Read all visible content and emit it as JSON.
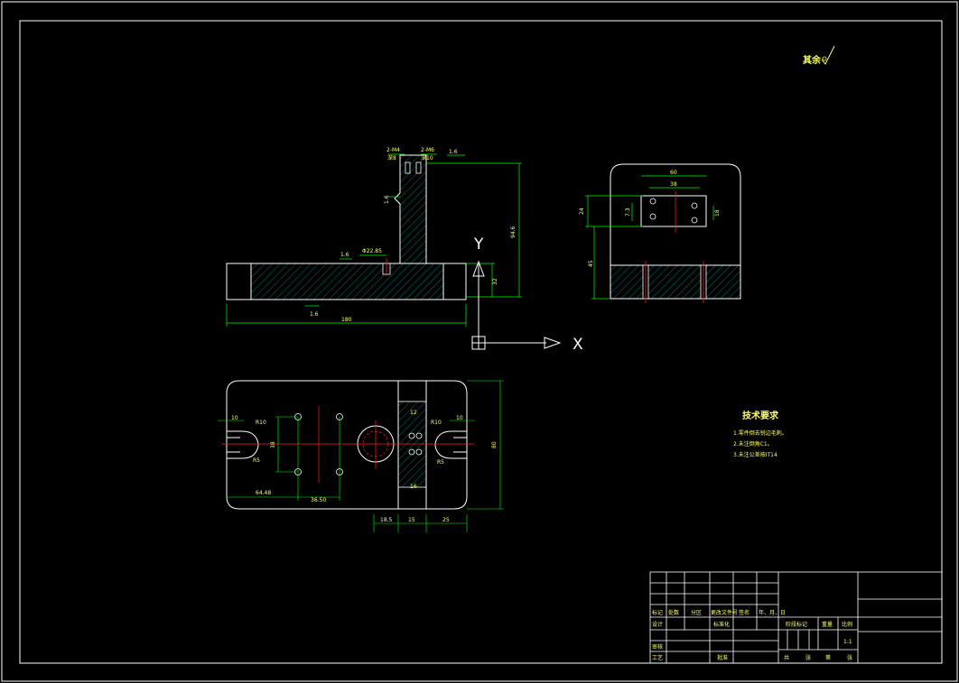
{
  "colors": {
    "background": "#000000",
    "outline": "#ffffff",
    "dimension": "#00ff00",
    "center_line": "#ff2020",
    "text": "#ffff66"
  },
  "surface_finish_note": "其余",
  "dimensions": {
    "front_thread_1": "2-M4",
    "front_thread_1_depth": "深8",
    "front_thread_2": "2-M6",
    "front_thread_2_depth": "深10",
    "roughness_top": "1.6",
    "roughness_side": "1.6",
    "roughness_base": "1.6",
    "roughness_step": "1.6",
    "bore_dia": "Φ22.85",
    "height_total": "94.6",
    "height_base": "32",
    "length_total": "180",
    "side_top_outer": "60",
    "side_top_inner": "38",
    "side_left_1": "24",
    "side_left_2": "7.3",
    "side_right_1": "18",
    "side_height": "45",
    "plan_left_slot": "10",
    "plan_right_slot": "10",
    "plan_r_left_top": "R10",
    "plan_r_left_bot": "R5",
    "plan_r_right_top": "R10",
    "plan_r_right_bot": "R5",
    "plan_hole_spacing_v": "38",
    "plan_left_offset": "64.48",
    "plan_hole_spacing_h": "36.50",
    "plan_bottom_1": "18.5",
    "plan_bottom_2": "15",
    "plan_bottom_3": "25",
    "plan_height": "80",
    "plan_small_1": "12",
    "plan_small_2": "16"
  },
  "axes": {
    "y_label": "Y",
    "x_label": "X"
  },
  "technical_requirements": {
    "title": "技术要求",
    "items": [
      "1.零件倒去锐边毛刺。",
      "2.未注倒角C1。",
      "3.未注公差按IT14"
    ]
  },
  "title_block": {
    "row_labels": [
      "标记",
      "处数",
      "分区",
      "更改文件号",
      "签名",
      "年、月、日"
    ],
    "designer": "设计",
    "standardization": "标准化",
    "reviewer": "审核",
    "process": "工艺",
    "approval": "批准",
    "stage_mark": "阶段标记",
    "weight": "重量",
    "scale": "比例",
    "scale_value": "1:1",
    "sheet_info": [
      "共",
      "张",
      "第",
      "张"
    ]
  }
}
